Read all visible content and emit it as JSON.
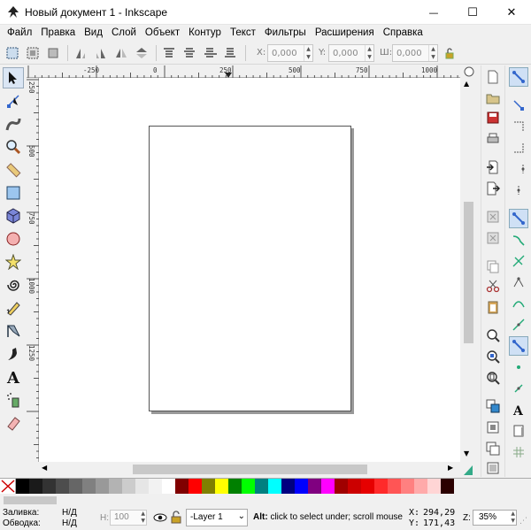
{
  "window": {
    "title": "Новый документ 1 - Inkscape",
    "minimize_glyph": "—",
    "maximize_glyph": "☐",
    "close_glyph": "✕"
  },
  "menu": [
    {
      "label": "Файл"
    },
    {
      "label": "Правка"
    },
    {
      "label": "Вид"
    },
    {
      "label": "Слой"
    },
    {
      "label": "Объект"
    },
    {
      "label": "Контур"
    },
    {
      "label": "Текст"
    },
    {
      "label": "Фильтры"
    },
    {
      "label": "Расширения"
    },
    {
      "label": "Справка"
    }
  ],
  "controls": {
    "x_label": "X:",
    "x_value": "0,000",
    "y_label": "Y:",
    "y_value": "0,000",
    "w_label": "Ш:",
    "w_value": "0,000"
  },
  "rulers": {
    "top_ticks": [
      "-250",
      "0",
      "250",
      "500",
      "750",
      "1000"
    ],
    "left_ticks": [
      "250",
      "500",
      "750",
      "1000",
      "1250"
    ]
  },
  "palette": {
    "colors": [
      "#000000",
      "#1a1a1a",
      "#333333",
      "#4d4d4d",
      "#666666",
      "#808080",
      "#999999",
      "#b3b3b3",
      "#cccccc",
      "#e6e6e6",
      "#f2f2f2",
      "#ffffff",
      "#800000",
      "#ff0000",
      "#808000",
      "#ffff00",
      "#008000",
      "#00ff00",
      "#008080",
      "#00ffff",
      "#000080",
      "#0000ff",
      "#800080",
      "#ff00ff",
      "#a00000",
      "#cc0000",
      "#e60000",
      "#ff2a2a",
      "#ff5555",
      "#ff8080",
      "#ffaaaa",
      "#ffd5d5",
      "#2b0000"
    ]
  },
  "status": {
    "fill_label": "Заливка:",
    "fill_value": "Н/Д",
    "stroke_label": "Обводка:",
    "stroke_value": "Н/Д",
    "opacity_label": "Н:",
    "opacity_value": "100",
    "layer_value": "-Layer 1",
    "message_bold": "Alt:",
    "message": " click to select under; scroll mouse",
    "x_label": "X:",
    "x_value": "294,29",
    "y_label": "Y:",
    "y_value": "171,43",
    "zoom_label": "Z:",
    "zoom_value": "35%"
  },
  "colors": {
    "active_tool_bg": "#dbe6f4",
    "snap_on_bg": "#cfe0f5"
  }
}
